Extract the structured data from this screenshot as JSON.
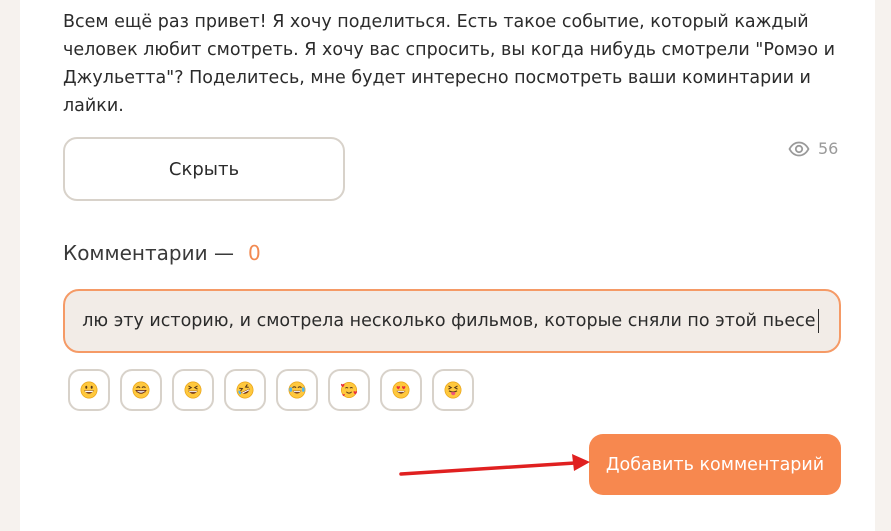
{
  "post": {
    "text": "Всем ещё раз привет! Я хочу поделиться. Есть такое событие, который каждый человек любит смотреть. Я хочу вас спросить, вы когда нибудь смотрели \"Ромэо и Джульетта\"? Поделитесь, мне будет интересно посмотреть ваши коминтарии и лайки."
  },
  "actions": {
    "hide_label": "Скрыть"
  },
  "views": {
    "icon": "eye-icon",
    "count": "56"
  },
  "comments": {
    "heading": "Комментарии —",
    "count": "0",
    "input_value": "лю эту историю, и смотрела несколько фильмов, которые сняли по этой пьесе",
    "emojis": [
      "grinning-face-with-big-eyes",
      "beaming-face-with-smiling-eyes",
      "grinning-squinting-face",
      "rolling-on-the-floor-laughing",
      "face-with-tears-of-joy",
      "smiling-face-with-hearts",
      "smiling-face-with-heart-eyes",
      "face-with-tongue"
    ],
    "submit_label": "Добавить комментарий"
  },
  "colors": {
    "accent": "#f7884f",
    "input_border": "#f59a66",
    "arrow": "#e02020"
  }
}
